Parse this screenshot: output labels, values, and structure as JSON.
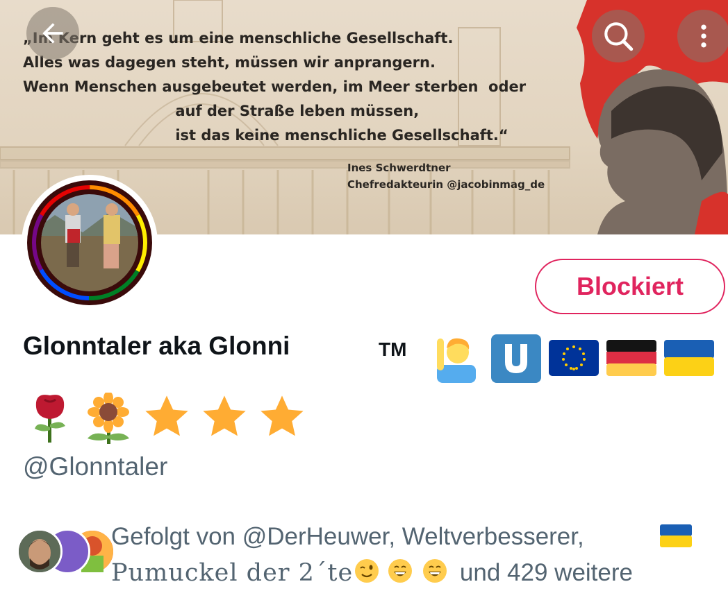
{
  "banner": {
    "quote_lines": [
      "„Im Kern geht es um eine menschliche Gesellschaft.",
      "Alles was dagegen steht, müssen wir anprangern.",
      "Wenn Menschen ausgebeutet werden, im Meer sterben  oder",
      "                              auf der Straße leben müssen,",
      "                              ist das keine menschliche Gesellschaft.“"
    ],
    "author_name": "Ines Schwerdtner",
    "author_title": "Chefredakteurin @jacobinmag_de"
  },
  "nav": {
    "back_icon": "arrow-left-icon",
    "search_icon": "search-icon",
    "more_icon": "more-vertical-icon"
  },
  "profile": {
    "block_label": "Blockiert",
    "display_name": "Glonntaler aka Glonni",
    "tm": "TM",
    "name_emojis": [
      "man-raising-hand",
      "u-bahn-sign",
      "eu-flag",
      "germany-flag",
      "ukraine-flag"
    ],
    "second_row_emojis": [
      "rose",
      "sunflower",
      "star",
      "star",
      "star"
    ],
    "handle": "@Glonntaler",
    "followed_by_line1": "Gefolgt von @DerHeuwer, Weltverbesserer,",
    "followed_by_name": "Pumuckel der 2´te",
    "followed_by_suffix": "und 429 weitere"
  },
  "colors": {
    "blocked_red": "#e0245e",
    "secondary_text": "#536471",
    "primary_text": "#0f1419"
  }
}
